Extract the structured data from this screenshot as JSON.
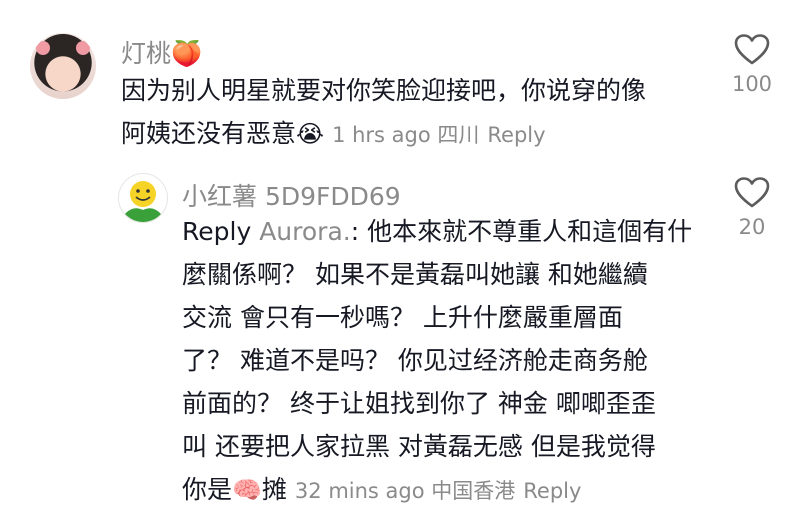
{
  "comments": [
    {
      "username": "灯桃",
      "username_emoji": "🍑",
      "lines": [
        "因为别人明星就要对你笑脸迎接吧，你说穿的像",
        "阿姨还没有恶意"
      ],
      "inline_emoji": "😭",
      "time": "1 hrs ago",
      "location": "四川",
      "reply_label": "Reply",
      "likes": "100"
    },
    {
      "username": "小红薯 5D9FDD69",
      "reply_prefix": "Reply",
      "mention": "Aurora.",
      "lines": [
        ": 他本來就不尊重人和這個有什",
        "麼關係啊？  如果不是黃磊叫她讓  和她繼續",
        "交流  會只有一秒嗎？  上升什麼嚴重層面",
        "了？  难道不是吗？  你见过经济舱走商务舱",
        "前面的？  终于让姐找到你了  神金  唧唧歪歪",
        "叫  还要把人家拉黑  对黃磊无感  但是我觉得",
        "你是"
      ],
      "inline_emoji": "🧠",
      "last_word": "摊",
      "time": "32 mins ago",
      "location": "中国香港",
      "reply_label": "Reply",
      "likes": "20"
    }
  ]
}
